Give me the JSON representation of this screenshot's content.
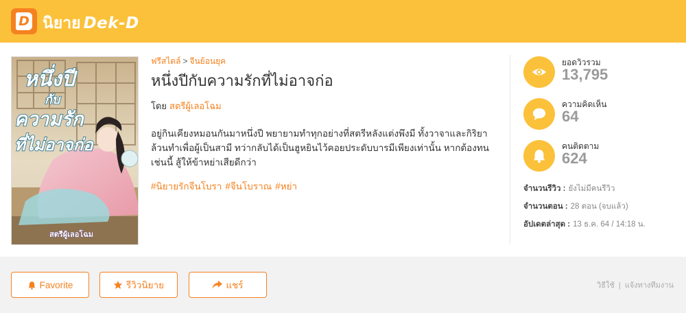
{
  "header": {
    "logo_letter": "D",
    "brand_thai": "นิยาย",
    "brand_en": "Dek-D"
  },
  "colors": {
    "accent": "#fcc13a",
    "brand_orange": "#f58220"
  },
  "story": {
    "breadcrumb": [
      {
        "label": "ฟรีสไตล์"
      },
      {
        "label": "จีนย้อนยุค"
      }
    ],
    "breadcrumb_separator": ">",
    "title": "หนึ่งปีกับความรักที่ไม่อาจก่อ",
    "author_prefix": "โดย",
    "author": "สตรีผู้เลอโฉม",
    "synopsis": "อยู่กินเคียงหมอนกันมาหนึ่งปี พยายามทำทุกอย่างที่สตรีหลังแต่งพึงมี ทั้งวาจาและกิริยาล้วนทำเพื่อผู้เป็นสามี ทว่ากลับได้เป็นฮูหยินไว้คอยประดับบารมีเพียงเท่านั้น หากต้องทนเช่นนี้ สู้ให้ข้าหย่าเสียดีกว่า",
    "tags": [
      "#นิยายรักจีนโบรา",
      "#จีนโบราณ",
      "#หย่า"
    ],
    "cover": {
      "title_line1": "หนึ่งปี",
      "title_line2": "กับ",
      "title_line3": "ความรัก",
      "title_line4": "ที่ไม่อาจก่อ",
      "author": "สตรีผู้เลอโฉม"
    }
  },
  "stats": [
    {
      "icon": "eye-icon",
      "label": "ยอดวิวรวม",
      "value": "13,795"
    },
    {
      "icon": "comment-icon",
      "label": "ความคิดเห็น",
      "value": "64"
    },
    {
      "icon": "bell-icon",
      "label": "คนติดตาม",
      "value": "624"
    }
  ],
  "info": {
    "reviews_label": "จำนวนรีวิว :",
    "reviews_value": "ยังไม่มีคนรีวิว",
    "chapters_label": "จำนวนตอน :",
    "chapters_value": "28 ตอน (จบแล้ว)",
    "updated_label": "อัปเดตล่าสุด :",
    "updated_value": "13 ธ.ค. 64 / 14:18 น."
  },
  "actions": {
    "favorite": "Favorite",
    "review": "รีวิวนิยาย",
    "share": "แชร์"
  },
  "footer_links": {
    "howto": "วิธีใช้",
    "divider": "|",
    "report": "แจ้งทางทีมงาน"
  }
}
